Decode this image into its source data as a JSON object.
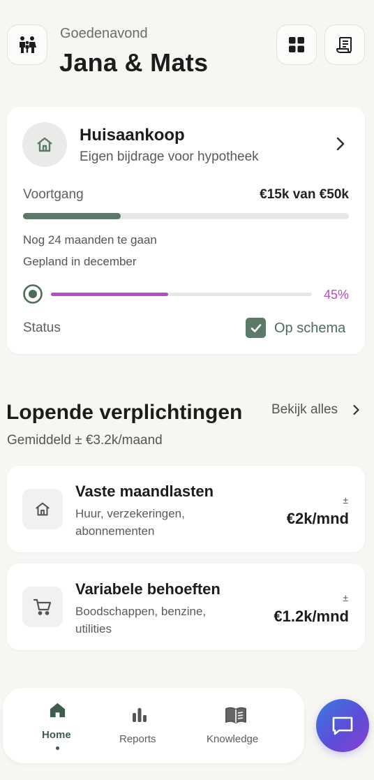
{
  "header": {
    "greeting": "Goedenavond",
    "names": "Jana & Mats"
  },
  "goal": {
    "title": "Huisaankoop",
    "subtitle": "Eigen bijdrage voor hypotheek",
    "progress_label": "Voortgang",
    "progress_value": "€15k van €50k",
    "progress_fraction": 0.3,
    "months_left": "Nog 24 maanden te gaan",
    "planned": "Gepland in december",
    "time_percent_label": "45%",
    "time_fraction": 0.45,
    "status_label": "Status",
    "status_value": "Op schema"
  },
  "obligations": {
    "title": "Lopende verplichtingen",
    "subtitle": "Gemiddeld ± €3.2k/maand",
    "see_all": "Bekijk alles",
    "items": [
      {
        "title": "Vaste maandlasten",
        "description": "Huur, verzekeringen, abonnementen",
        "approx": "±",
        "amount": "€2k/mnd",
        "icon": "home-icon"
      },
      {
        "title": "Variabele behoeften",
        "description": "Boodschappen, benzine, utilities",
        "approx": "±",
        "amount": "€1.2k/mnd",
        "icon": "cart-icon"
      }
    ]
  },
  "nav": {
    "items": [
      {
        "label": "Home",
        "icon": "home-icon",
        "active": true
      },
      {
        "label": "Reports",
        "icon": "bar-chart-icon",
        "active": false
      },
      {
        "label": "Knowledge",
        "icon": "book-icon",
        "active": false
      }
    ]
  },
  "colors": {
    "accent_green": "#5c7a69",
    "accent_purple": "#b44fc3",
    "chat_gradient_start": "#3c7be0",
    "chat_gradient_end": "#8a3fd0"
  }
}
